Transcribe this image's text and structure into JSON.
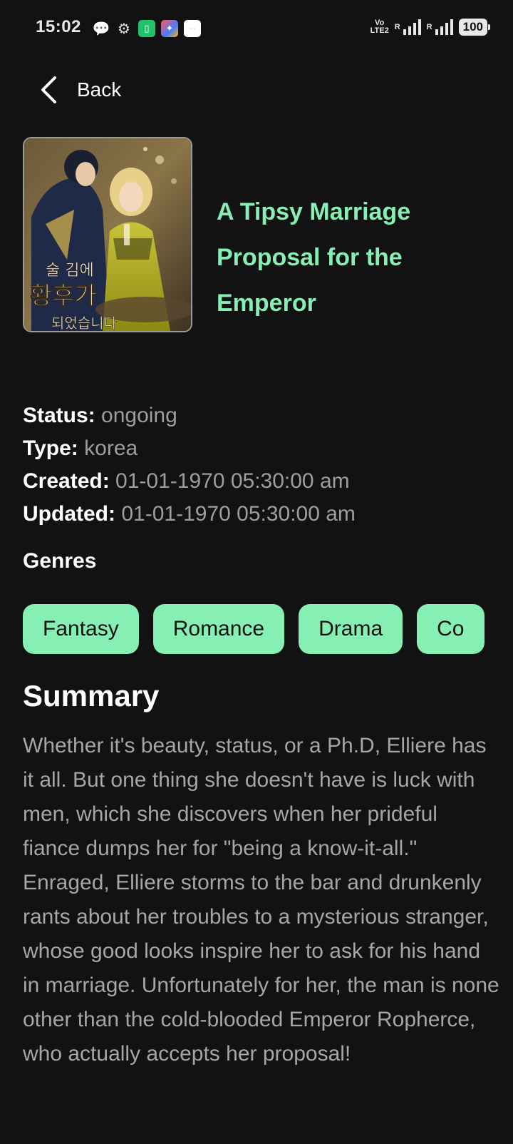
{
  "status_bar": {
    "time": "15:02",
    "icons": [
      "chat-icon",
      "gear-icon",
      "battery-saver-app-icon",
      "app-icon",
      "white-app-icon"
    ],
    "volte_line1": "Vo",
    "volte_line2": "LTE2",
    "roaming_1": "R",
    "roaming_2": "R",
    "battery": "100"
  },
  "header": {
    "back_label": "Back",
    "back_icon": "chevron-left-icon"
  },
  "manga": {
    "title": "A Tipsy Marriage Proposal for the Emperor",
    "cover_text_line1": "술 김에",
    "cover_text_line2": "황후가",
    "cover_text_line3": "되었습니다"
  },
  "info": {
    "status_label": "Status:",
    "status_value": "ongoing",
    "type_label": "Type:",
    "type_value": "korea",
    "created_label": "Created:",
    "created_value": "01-01-1970 05:30:00 am",
    "updated_label": "Updated:",
    "updated_value": "01-01-1970 05:30:00 am"
  },
  "genres": {
    "heading": "Genres",
    "items": [
      "Fantasy",
      "Romance",
      "Drama",
      "Co"
    ]
  },
  "summary": {
    "heading": "Summary",
    "text": "Whether it's beauty, status, or a Ph.D, Elliere has it all. But one thing she doesn't have is luck with men, which she discovers when her prideful fiance dumps her for \"being a know-it-all.\"\nEnraged, Elliere storms to the bar and drunkenly rants about her troubles to a mysterious stranger, whose good looks inspire her to ask for his hand in marriage. Unfortunately for her, the man is none other than the cold-blooded Emperor Ropherce, who actually accepts her proposal!"
  },
  "colors": {
    "background": "#121212",
    "accent": "#86efb3",
    "muted_text": "#9e9e9e"
  }
}
